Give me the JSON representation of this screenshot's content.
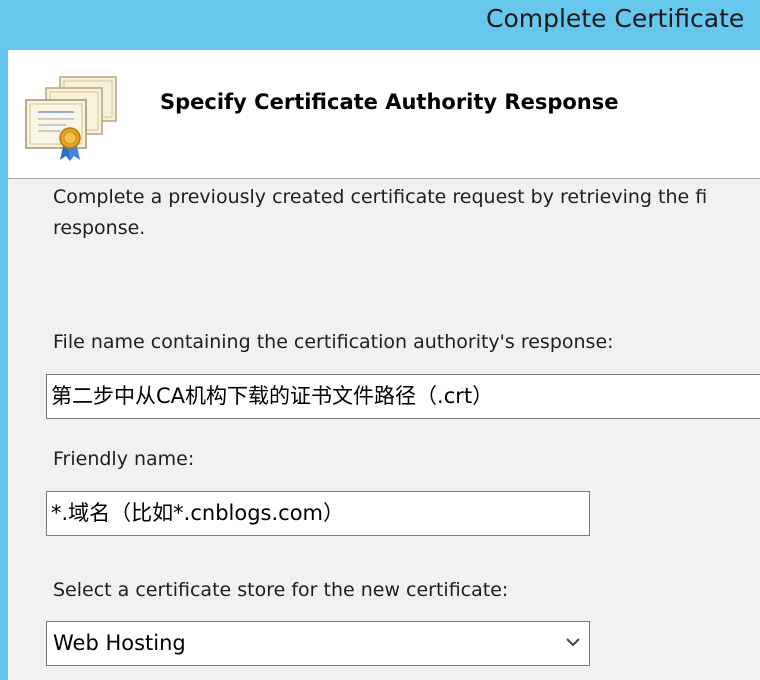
{
  "window": {
    "title": "Complete Certificate"
  },
  "header": {
    "title": "Specify Certificate Authority Response",
    "icon": "certificate-icon"
  },
  "body": {
    "description_line1": "Complete a previously created certificate request by retrieving the fi",
    "description_line2": "response."
  },
  "form": {
    "file_label": "File name containing the certification authority's response:",
    "file_value": "第二步中从CA机构下载的证书文件路径（.crt）",
    "friendly_label": "Friendly name:",
    "friendly_value": "*.域名（比如*.cnblogs.com）",
    "store_label": "Select a certificate store for the new certificate:",
    "store_value": "Web Hosting"
  },
  "colors": {
    "title_bar": "#66c8ec",
    "client_bg": "#f3f0f3",
    "header_bg": "#ffffff"
  }
}
